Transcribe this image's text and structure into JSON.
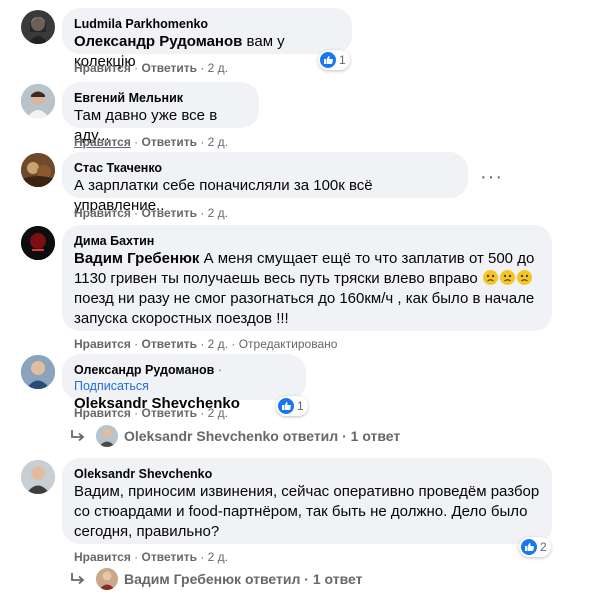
{
  "comments": [
    {
      "author": "Ludmila Parkhomenko",
      "mention": "Олександр Рудоманов",
      "text": " вам у колекцію",
      "actions": {
        "like": "Нравится",
        "reply": "Ответить",
        "time": "2 д."
      },
      "reaction_count": "1"
    },
    {
      "author": "Евгений Мельник",
      "text": "Там давно уже все в аду...",
      "actions": {
        "like": "Нравится",
        "reply": "Ответить",
        "time": "2 д."
      }
    },
    {
      "author": "Стас Ткаченко",
      "text": "А зарплатки себе поначисляли за 100к всё управление..",
      "actions": {
        "like": "Нравится",
        "reply": "Ответить",
        "time": "2 д."
      },
      "more_icon": "ellipsis-icon"
    },
    {
      "author": "Дима Бахтин",
      "mention": "Вадим Гребенюк",
      "text_line1": " А меня смущает ещё то что заплатив от 500 до",
      "text_line2": "1130 гривен ты получаешь весь путь тряски влево вправо",
      "text_line3": "поезд ни разу не смог разогнаться до 160км/ч , как было в начале",
      "text_line4": "запуска скоростных поездов !!!",
      "actions": {
        "like": "Нравится",
        "reply": "Ответить",
        "time": "2 д.",
        "edited": "Отредактировано"
      }
    },
    {
      "author": "Олександр Рудоманов",
      "follow": "Подписаться",
      "mention": "Oleksandr Shevchenko",
      "actions": {
        "like": "Нравится",
        "reply": "Ответить",
        "time": "2 д."
      },
      "reaction_count": "1",
      "replies": {
        "name": "Oleksandr Shevchenko",
        "verb": "ответил",
        "count": "1 ответ"
      }
    },
    {
      "author": "Oleksandr Shevchenko",
      "text_line1": "Вадим, приносим извинения, сейчас оперативно проведём разбор",
      "text_line2": "со стюардами и food-партнёром, так быть не должно. Дело было",
      "text_line3": "сегодня, правильно?",
      "actions": {
        "like": "Нравится",
        "reply": "Ответить",
        "time": "2 д."
      },
      "reaction_count": "2",
      "replies": {
        "name": "Вадим Гребенюк",
        "verb": "ответил",
        "count": "1 ответ"
      }
    }
  ],
  "separator": "·",
  "colors": {
    "bubble": "#f0f2f5",
    "link": "#216fdb",
    "meta": "#65676b",
    "like": "#1877f2"
  }
}
